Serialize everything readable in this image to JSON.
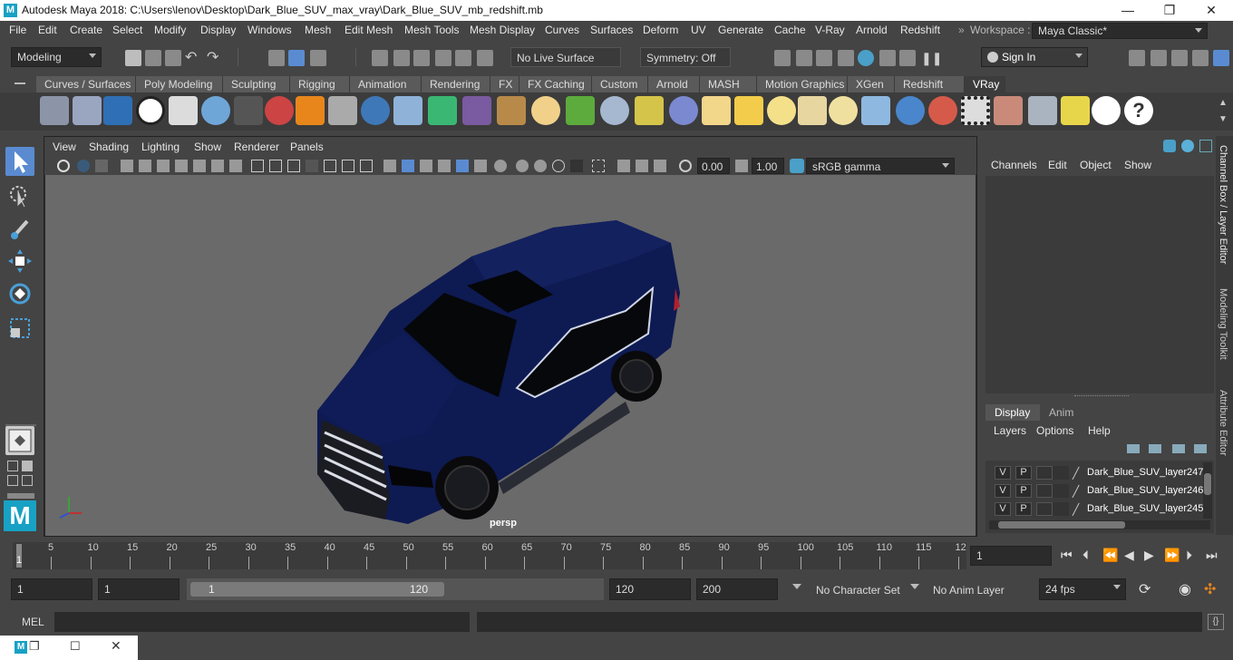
{
  "window": {
    "title": "Autodesk Maya 2018: C:\\Users\\lenov\\Desktop\\Dark_Blue_SUV_max_vray\\Dark_Blue_SUV_mb_redshift.mb",
    "logo": "M",
    "minimize": "—",
    "maximize": "❐",
    "close": "✕"
  },
  "menubar": {
    "items": [
      "File",
      "Edit",
      "Create",
      "Select",
      "Modify",
      "Display",
      "Windows",
      "Mesh",
      "Edit Mesh",
      "Mesh Tools",
      "Mesh Display",
      "Curves",
      "Surfaces",
      "Deform",
      "UV",
      "Generate",
      "Cache",
      "V-Ray",
      "Arnold",
      "Redshift"
    ],
    "workspace_label": "Workspace :",
    "workspace_value": "Maya Classic*"
  },
  "statusline": {
    "menuset": "Modeling",
    "live_surface": "No Live Surface",
    "symmetry": "Symmetry: Off",
    "sign_in": "Sign In"
  },
  "shelf": {
    "tabs": [
      "Curves / Surfaces",
      "Poly Modeling",
      "Sculpting",
      "Rigging",
      "Animation",
      "Rendering",
      "FX",
      "FX Caching",
      "Custom",
      "Arnold",
      "MASH",
      "Motion Graphics",
      "XGen",
      "Redshift",
      "VRay"
    ],
    "active_tab": "VRay"
  },
  "panel": {
    "menus": [
      "View",
      "Shading",
      "Lighting",
      "Show",
      "Renderer",
      "Panels"
    ],
    "exposure": "0.00",
    "gamma": "1.00",
    "color_space": "sRGB gamma",
    "camera_label": "persp"
  },
  "channelbox": {
    "menus": [
      "Channels",
      "Edit",
      "Object",
      "Show"
    ],
    "layer_tabs": [
      "Display",
      "Anim"
    ],
    "layer_menus": [
      "Layers",
      "Options",
      "Help"
    ],
    "layers": [
      {
        "v": "V",
        "p": "P",
        "name": "Dark_Blue_SUV_layer247"
      },
      {
        "v": "V",
        "p": "P",
        "name": "Dark_Blue_SUV_layer246"
      },
      {
        "v": "V",
        "p": "P",
        "name": "Dark_Blue_SUV_layer245"
      }
    ]
  },
  "side_tabs": [
    "Channel Box / Layer Editor",
    "Modeling Toolkit",
    "Attribute Editor"
  ],
  "timeline": {
    "ticks": [
      "5",
      "10",
      "15",
      "20",
      "25",
      "30",
      "35",
      "40",
      "45",
      "50",
      "55",
      "60",
      "65",
      "70",
      "75",
      "80",
      "85",
      "90",
      "95",
      "100",
      "105",
      "110",
      "115",
      "12"
    ],
    "current_marker": "1",
    "current_frame": "1"
  },
  "range": {
    "start": "1",
    "anim_start": "1",
    "slider_start": "1",
    "slider_end": "120",
    "anim_end": "120",
    "end": "200",
    "character_set": "No Character Set",
    "anim_layer": "No Anim Layer",
    "fps": "24 fps"
  },
  "cmdline": {
    "label": "MEL"
  },
  "colors": {
    "ui_bg": "#444444",
    "viewport_bg": "#6a6a6a",
    "car_body": "#0e1a52",
    "accent": "#5a8bd1"
  }
}
